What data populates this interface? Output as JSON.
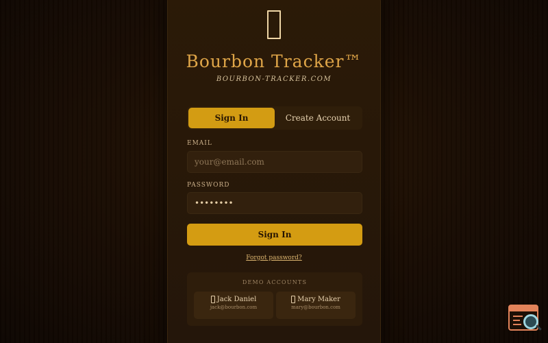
{
  "brand": {
    "title": "Bourbon Tracker™",
    "subtitle": "BOURBON-TRACKER.COM",
    "logo_icon": "bottle-icon"
  },
  "tabs": [
    {
      "label": "Sign In",
      "active": true
    },
    {
      "label": "Create Account",
      "active": false
    }
  ],
  "form": {
    "email_label": "EMAIL",
    "email_placeholder": "your@email.com",
    "password_label": "PASSWORD",
    "password_value": "••••••••",
    "submit_label": "Sign In",
    "forgot_label": "Forgot password?"
  },
  "demo": {
    "title": "DEMO ACCOUNTS",
    "accounts": [
      {
        "name": "Jack Daniel",
        "email": "jack@bourbon.com"
      },
      {
        "name": "Mary Maker",
        "email": "mary@bourbon.com"
      }
    ]
  },
  "colors": {
    "accent": "#d49c12",
    "title": "#dfa548",
    "background": "#1a0d03"
  }
}
